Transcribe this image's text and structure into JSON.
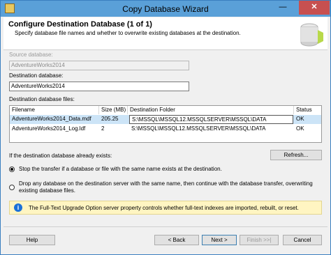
{
  "window": {
    "title": "Copy Database Wizard",
    "controls": {
      "minimize": "—",
      "maximize": "☐",
      "close": "✕"
    }
  },
  "header": {
    "title": "Configure Destination Database (1 of 1)",
    "subtitle": "Specify database file names and whether to overwrite existing databases at the destination."
  },
  "source": {
    "label": "Source database:",
    "value": "AdventureWorks2014"
  },
  "destination": {
    "label": "Destination database:",
    "value": "AdventureWorks2014"
  },
  "files": {
    "label": "Destination database files:",
    "columns": [
      "Filename",
      "Size (MB)",
      "Destination Folder",
      "Status"
    ],
    "rows": [
      {
        "filename": "AdventureWorks2014_Data.mdf",
        "size": "205.25",
        "folder": "S:\\MSSQL\\MSSQL12.MSSQLSERVER\\MSSQL\\DATA",
        "status": "OK"
      },
      {
        "filename": "AdventureWorks2014_Log.ldf",
        "size": "2",
        "folder": "S:\\MSSQL\\MSSQL12.MSSQLSERVER\\MSSQL\\DATA",
        "status": "OK"
      }
    ]
  },
  "exists": {
    "label": "If the destination database already exists:",
    "refresh": "Refresh...",
    "option1": "Stop the transfer if a database or file with the same name exists at the destination.",
    "option2_line1": "Drop any database on the destination server with the same name, then continue with the database transfer, overwriting",
    "option2_line2": "existing database files.",
    "selected": 1
  },
  "info": {
    "text": "The Full-Text Upgrade Option server property controls whether full-text indexes are imported, rebuilt, or reset."
  },
  "buttons": {
    "help": "Help",
    "back": "< Back",
    "next": "Next >",
    "finish": "Finish >>|",
    "cancel": "Cancel"
  }
}
